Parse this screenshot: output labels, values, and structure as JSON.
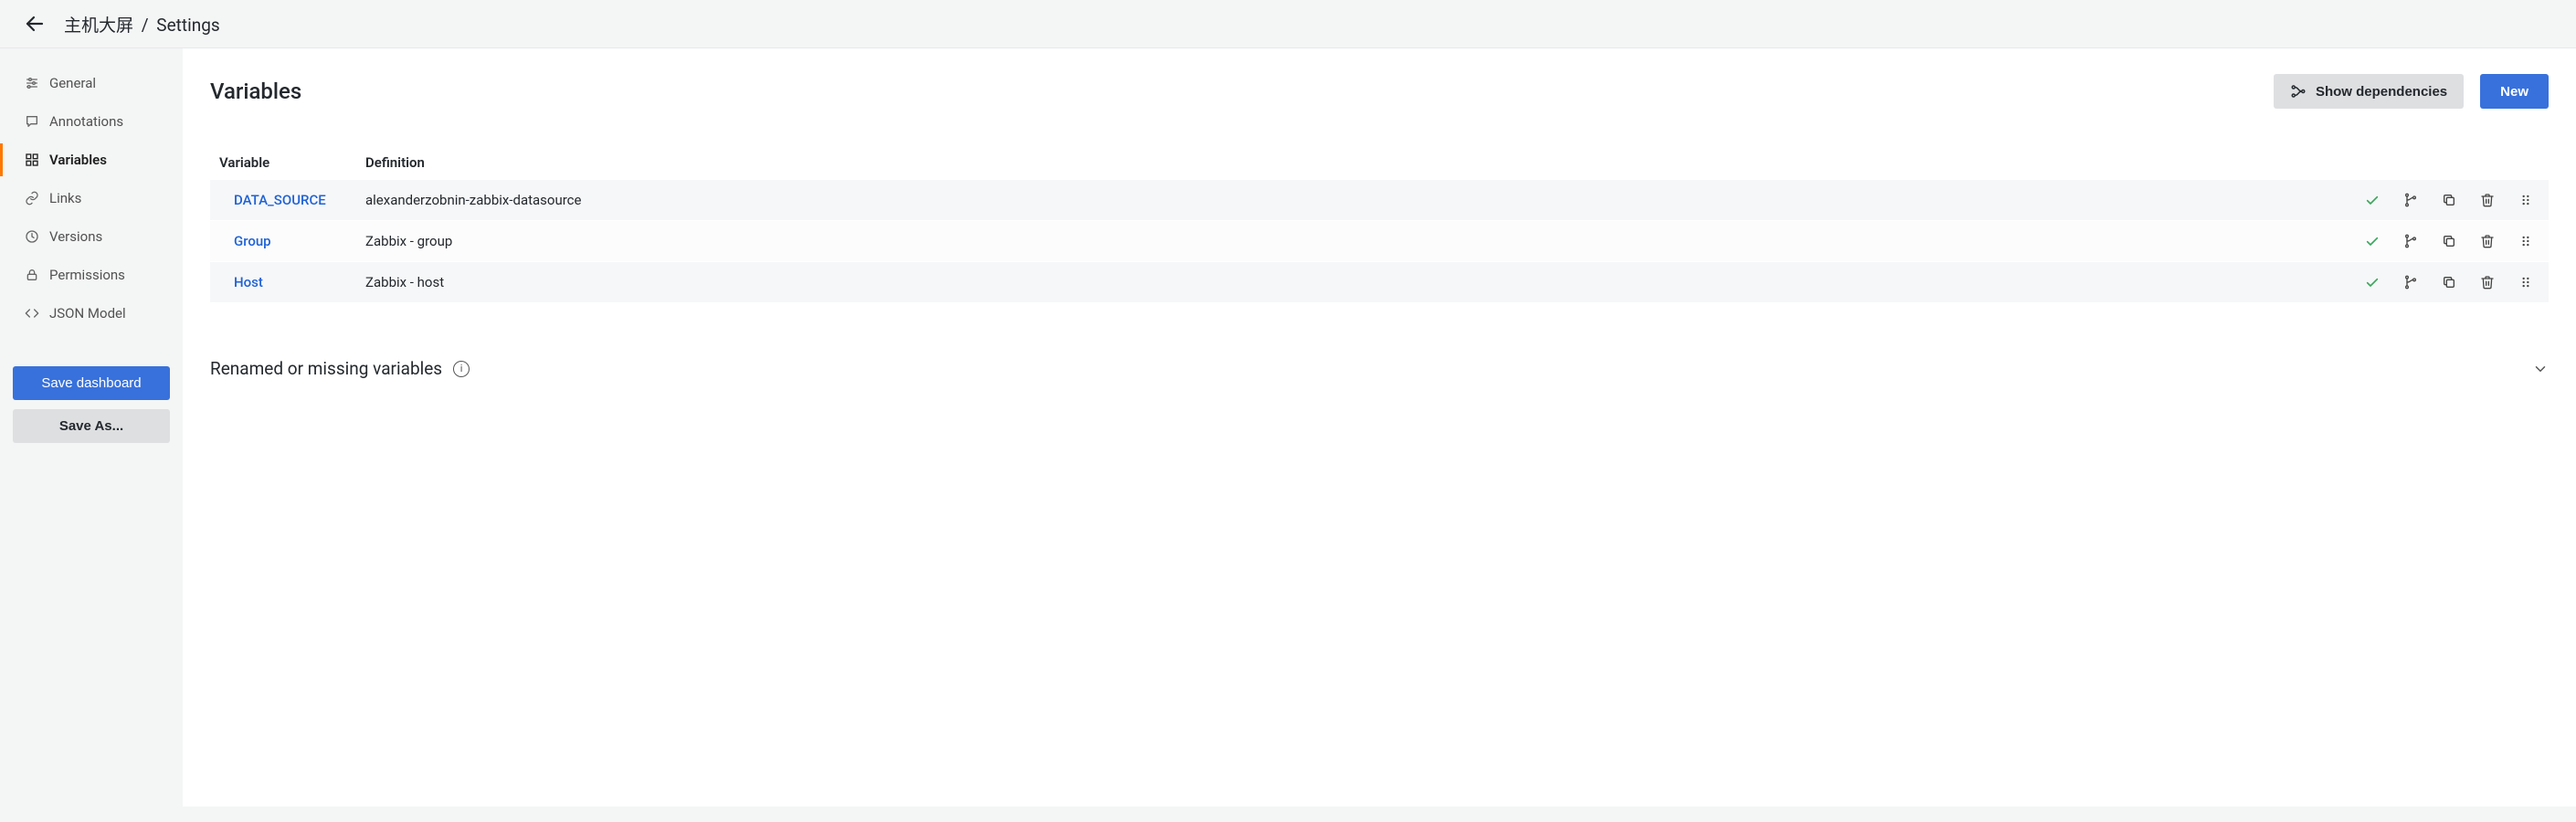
{
  "header": {
    "dashboard_name": "主机大屏",
    "separator": "/",
    "page_label": "Settings"
  },
  "sidebar": {
    "items": [
      {
        "label": "General",
        "icon": "sliders-icon",
        "active": false
      },
      {
        "label": "Annotations",
        "icon": "comment-icon",
        "active": false
      },
      {
        "label": "Variables",
        "icon": "grid-icon",
        "active": true
      },
      {
        "label": "Links",
        "icon": "link-icon",
        "active": false
      },
      {
        "label": "Versions",
        "icon": "history-icon",
        "active": false
      },
      {
        "label": "Permissions",
        "icon": "lock-icon",
        "active": false
      },
      {
        "label": "JSON Model",
        "icon": "code-icon",
        "active": false
      }
    ],
    "save_dashboard": "Save dashboard",
    "save_as": "Save As..."
  },
  "main": {
    "title": "Variables",
    "show_dependencies": "Show dependencies",
    "new": "New",
    "columns": {
      "variable": "Variable",
      "definition": "Definition"
    },
    "rows": [
      {
        "name": "DATA_SOURCE",
        "definition": "alexanderzobnin-zabbix-datasource"
      },
      {
        "name": "Group",
        "definition": "Zabbix - group"
      },
      {
        "name": "Host",
        "definition": "Zabbix - host"
      }
    ],
    "renamed_section": "Renamed or missing variables"
  }
}
